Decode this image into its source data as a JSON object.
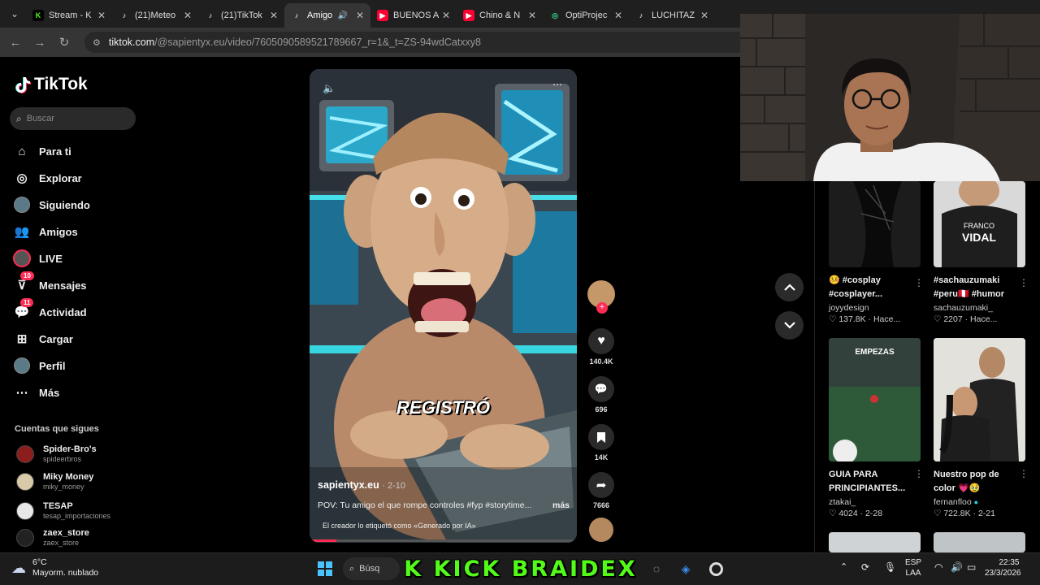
{
  "browser": {
    "tabs": [
      {
        "title": "Stream - K",
        "icon": "kick-icon",
        "color": "#53fc18"
      },
      {
        "title": "(21)Meteo",
        "icon": "tiktok-icon",
        "color": "#ffffff"
      },
      {
        "title": "(21)TikTok",
        "icon": "tiktok-icon",
        "color": "#ffffff"
      },
      {
        "title": "Amigo",
        "icon": "tiktok-icon",
        "color": "#ffffff",
        "active": true
      },
      {
        "title": "BUENOS A",
        "icon": "youtube-icon",
        "color": "#ff0033"
      },
      {
        "title": "Chino & N",
        "icon": "youtube-icon",
        "color": "#ff0033"
      },
      {
        "title": "OptiProjec",
        "icon": "opti-icon",
        "color": "#2fd38a"
      },
      {
        "title": "LUCHITAZ",
        "icon": "tiktok-icon",
        "color": "#ffffff"
      }
    ],
    "url_host": "tiktok.com",
    "url_path": "/@sapientyx.eu/video/7605090589521789667_r=1&_t=ZS-94wdCatxxy8"
  },
  "sidebar": {
    "logo": "TikTok",
    "search_placeholder": "Buscar",
    "menu": [
      {
        "label": "Para ti",
        "icon": "home-icon"
      },
      {
        "label": "Explorar",
        "icon": "compass-icon"
      },
      {
        "label": "Siguiendo",
        "icon": "following-avatar-icon"
      },
      {
        "label": "Amigos",
        "icon": "friends-icon"
      },
      {
        "label": "LIVE",
        "icon": "live-icon"
      },
      {
        "label": "Mensajes",
        "icon": "messages-icon",
        "badge": "10"
      },
      {
        "label": "Actividad",
        "icon": "activity-icon",
        "badge": "11"
      },
      {
        "label": "Cargar",
        "icon": "upload-icon"
      },
      {
        "label": "Perfil",
        "icon": "profile-icon"
      },
      {
        "label": "Más",
        "icon": "more-icon"
      }
    ],
    "following_header": "Cuentas que sigues",
    "following": [
      {
        "name": "Spider-Bro's",
        "handle": "spideerbros",
        "color": "#8c1d1d"
      },
      {
        "name": "Miky Money",
        "handle": "miky_money",
        "color": "#d8c9a8"
      },
      {
        "name": "TESAP",
        "handle": "tesap_importaciones",
        "color": "#e8e8e8"
      },
      {
        "name": "zaex_store",
        "handle": "zaex_store",
        "color": "#222222"
      }
    ]
  },
  "video": {
    "caption_overlay": "REGISTRÓ",
    "author": "sapientyx.eu",
    "date": "2-10",
    "description": "POV: Tu amigo el que rompe controles #fyp #storytime...",
    "more": "más",
    "ai_label": "El creador lo etiquetó como «Generado por IA»"
  },
  "actions": {
    "likes": "140.4K",
    "comments": "696",
    "saves": "14K",
    "shares": "7666"
  },
  "recommended": [
    {
      "title1": "🤒 #cosplay",
      "title2": "#cosplayer...",
      "user": "joyydesign",
      "likes": "137.8K",
      "date": "Hace..."
    },
    {
      "title1": "#sachauzumaki",
      "title2": "#peru🇵🇪 #humor",
      "user": "sachauzumaki_",
      "likes": "2207",
      "date": "Hace..."
    },
    {
      "title1": "GUIA PARA",
      "title2": "PRINCIPIANTES...",
      "user": "ztakai_",
      "likes": "4024",
      "date": "2-28",
      "thumb_text": "EMPEZAS"
    },
    {
      "title1": "Nuestro pop de",
      "title2": "color 💗🥹",
      "user": "fernanfloo",
      "likes": "722.8K",
      "date": "2-21",
      "verified": true
    }
  ],
  "taskbar": {
    "temp": "6°C",
    "weather": "Mayorm. nublado",
    "search": "Búsq",
    "lang1": "ESP",
    "lang2": "LAA",
    "time": "22:35",
    "date": "23/3/2026"
  },
  "stream_overlay": {
    "text": "K KICK BRAIDEX"
  }
}
